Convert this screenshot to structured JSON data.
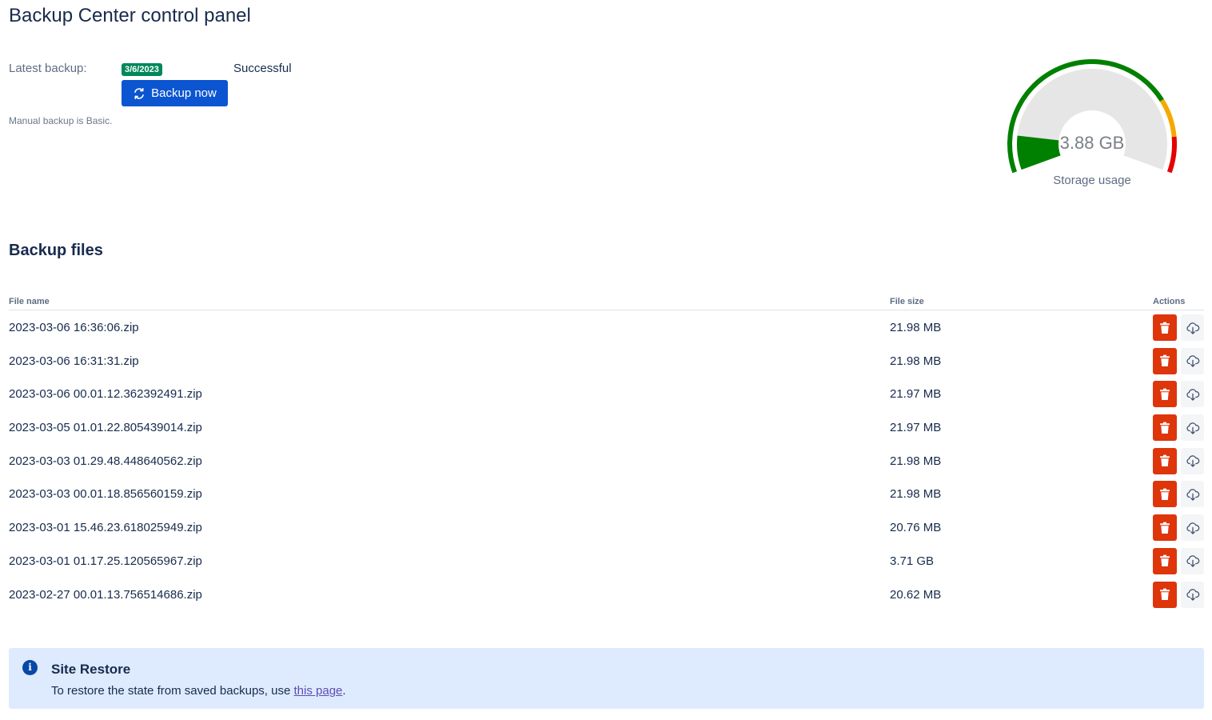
{
  "page": {
    "title": "Backup Center control panel"
  },
  "latest_backup": {
    "label": "Latest backup:",
    "date": "3/6/2023",
    "status": "Successful",
    "button_label": "Backup now",
    "note": "Manual backup is Basic."
  },
  "storage": {
    "value": "3.88 GB",
    "label": "Storage usage",
    "usage_fraction": 0.12,
    "colors": {
      "fill": "#008000",
      "track": "#e6e6e6",
      "ok": "#008000",
      "warning": "#f6a800",
      "danger": "#e60000"
    }
  },
  "files_section": {
    "title": "Backup files",
    "columns": {
      "name": "File name",
      "size": "File size",
      "actions": "Actions"
    },
    "rows": [
      {
        "name": "2023-03-06 16:36:06.zip",
        "size": "21.98 MB"
      },
      {
        "name": "2023-03-06 16:31:31.zip",
        "size": "21.98 MB"
      },
      {
        "name": "2023-03-06 00.01.12.362392491.zip",
        "size": "21.97 MB"
      },
      {
        "name": "2023-03-05 01.01.22.805439014.zip",
        "size": "21.97 MB"
      },
      {
        "name": "2023-03-03 01.29.48.448640562.zip",
        "size": "21.98 MB"
      },
      {
        "name": "2023-03-03 00.01.18.856560159.zip",
        "size": "21.98 MB"
      },
      {
        "name": "2023-03-01 15.46.23.618025949.zip",
        "size": "20.76 MB"
      },
      {
        "name": "2023-03-01 01.17.25.120565967.zip",
        "size": "3.71 GB"
      },
      {
        "name": "2023-02-27 00.01.13.756514686.zip",
        "size": "20.62 MB"
      }
    ],
    "icons": {
      "delete": "trash-icon",
      "download": "cloud-download-icon"
    }
  },
  "restore": {
    "icon": "info-icon",
    "icon_glyph": "i",
    "title": "Site Restore",
    "text_before": "To restore the state from saved backups, use ",
    "link_text": "this page",
    "text_after": "."
  }
}
